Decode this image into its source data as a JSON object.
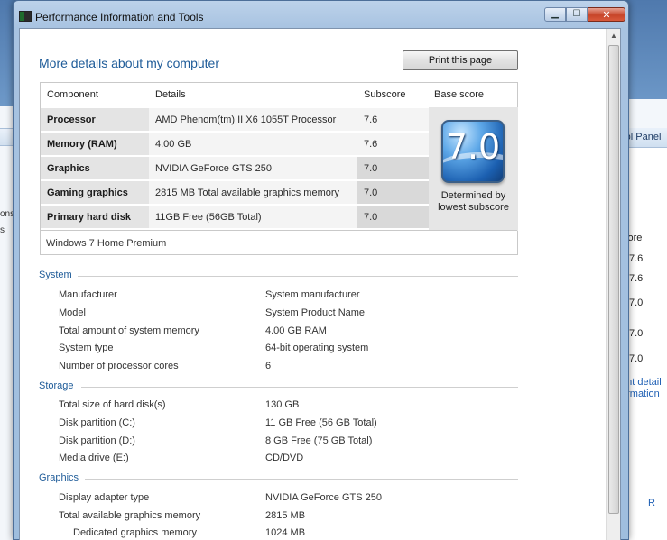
{
  "window": {
    "title": "Performance Information and Tools"
  },
  "controls": {
    "minimize": "▁",
    "maximize": "☐",
    "close": "✕"
  },
  "page": {
    "heading": "More details about my computer",
    "print_button": "Print this page"
  },
  "score_table": {
    "headers": [
      "Component",
      "Details",
      "Subscore",
      "Base score"
    ],
    "rows": [
      {
        "component": "Processor",
        "details": "AMD Phenom(tm) II X6 1055T Processor",
        "subscore": "7.6"
      },
      {
        "component": "Memory (RAM)",
        "details": "4.00 GB",
        "subscore": "7.6"
      },
      {
        "component": "Graphics",
        "details": "NVIDIA GeForce GTS 250",
        "subscore": "7.0"
      },
      {
        "component": "Gaming graphics",
        "details": "2815 MB Total available graphics memory",
        "subscore": "7.0"
      },
      {
        "component": "Primary hard disk",
        "details": "11GB Free (56GB Total)",
        "subscore": "7.0"
      }
    ],
    "base_score": "7.0",
    "base_note_line1": "Determined by",
    "base_note_line2": "lowest subscore",
    "edition": "Windows 7 Home Premium"
  },
  "system": {
    "title": "System",
    "items": [
      {
        "label": "Manufacturer",
        "value": "System manufacturer"
      },
      {
        "label": "Model",
        "value": "System Product Name"
      },
      {
        "label": "Total amount of system memory",
        "value": "4.00 GB RAM"
      },
      {
        "label": "System type",
        "value": "64-bit operating system"
      },
      {
        "label": "Number of processor cores",
        "value": "6"
      }
    ]
  },
  "storage": {
    "title": "Storage",
    "items": [
      {
        "label": "Total size of hard disk(s)",
        "value": "130 GB"
      },
      {
        "label": "Disk partition (C:)",
        "value": "11 GB Free (56 GB Total)"
      },
      {
        "label": "Disk partition (D:)",
        "value": "8 GB Free (75 GB Total)"
      },
      {
        "label": "Media drive (E:)",
        "value": "CD/DVD"
      }
    ]
  },
  "graphics": {
    "title": "Graphics",
    "items": [
      {
        "label": "Display adapter type",
        "value": "NVIDIA GeForce GTS 250"
      },
      {
        "label": "Total available graphics memory",
        "value": "2815 MB"
      },
      {
        "label": "Dedicated graphics memory",
        "value": "1024 MB"
      }
    ]
  },
  "background_window": {
    "bar_text": "rol Panel",
    "column_header": "core",
    "scores": [
      "7.6",
      "7.6",
      "7.0",
      "7.0",
      "7.0"
    ],
    "link1": "rint detail",
    "link2": "ormation",
    "footer_text": "R",
    "left_text1": "ons",
    "left_text2": "s"
  }
}
